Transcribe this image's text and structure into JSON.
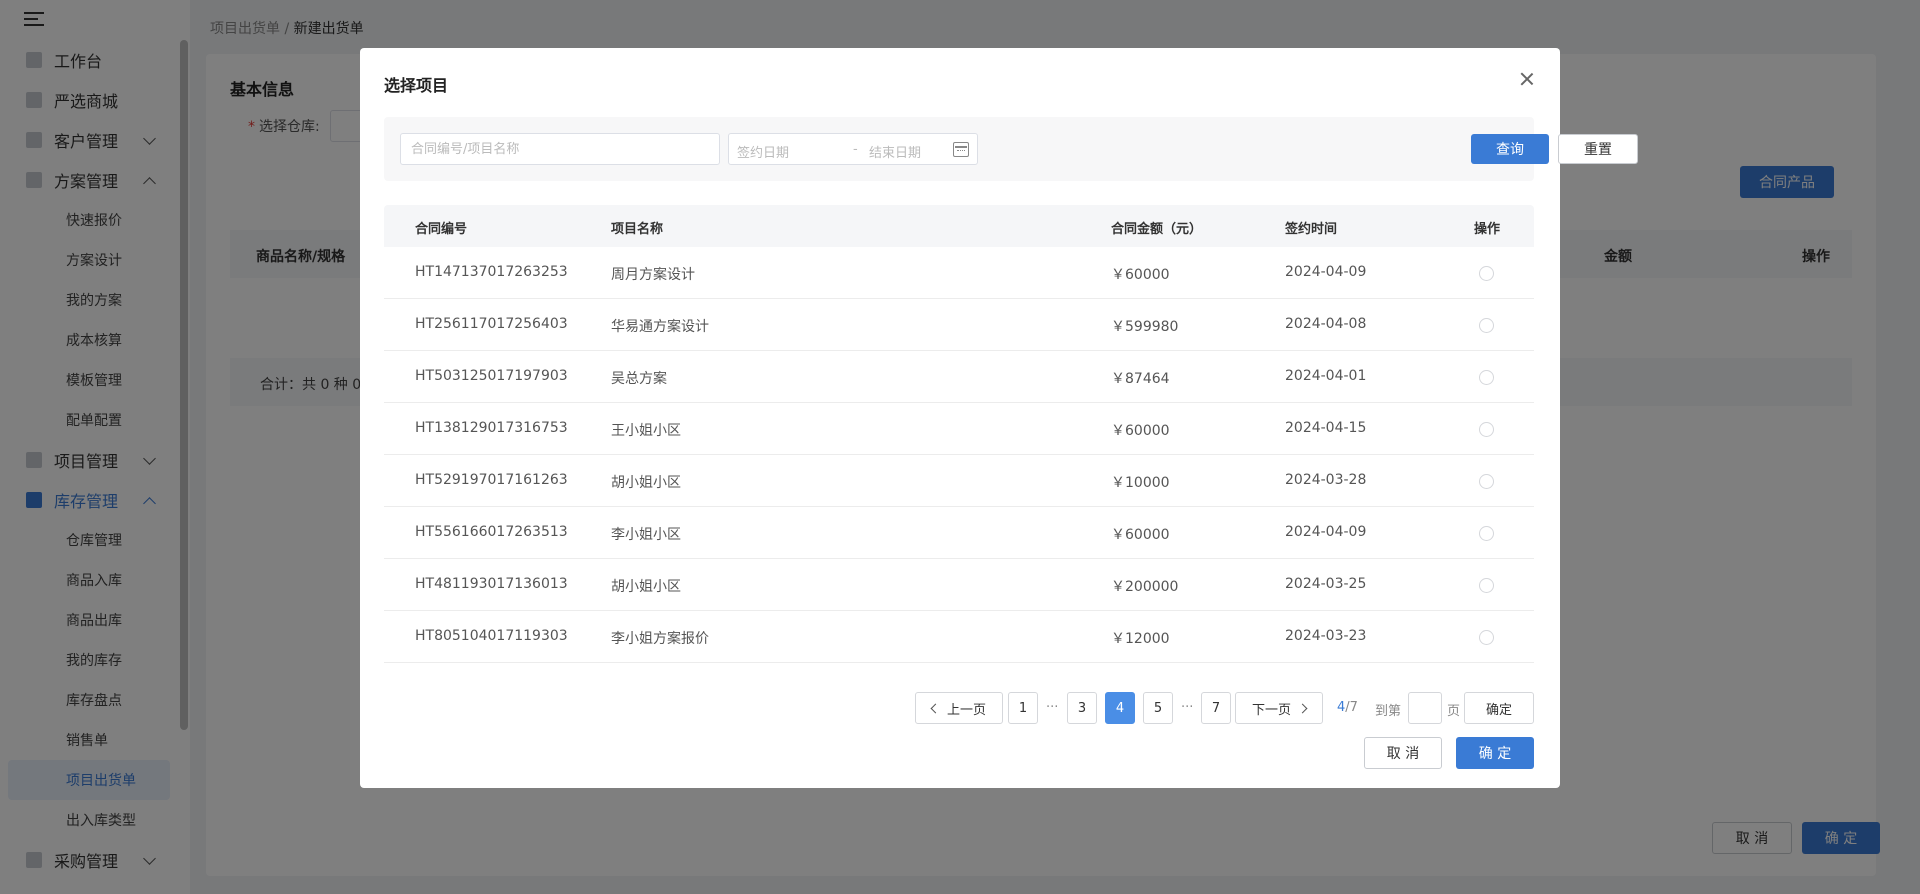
{
  "sidebar": {
    "items": [
      {
        "label": "工作台"
      },
      {
        "label": "严选商城"
      },
      {
        "label": "客户管理"
      },
      {
        "label": "方案管理"
      },
      {
        "label": "项目管理"
      },
      {
        "label": "库存管理"
      },
      {
        "label": "采购管理"
      }
    ],
    "plan_sub": [
      "快速报价",
      "方案设计",
      "我的方案",
      "成本核算",
      "模板管理",
      "配单配置"
    ],
    "stock_sub": [
      "仓库管理",
      "商品入库",
      "商品出库",
      "我的库存",
      "库存盘点",
      "销售单",
      "项目出货单",
      "出入库类型"
    ]
  },
  "breadcrumb": {
    "parent": "项目出货单",
    "sep": "/",
    "current": "新建出货单"
  },
  "page": {
    "title": "基本信息",
    "warehouse_label": "选择仓库:",
    "required_mark": "*",
    "contract_button": "合同产品",
    "table_headers": {
      "name": "商品名称/规格",
      "amount": "金额",
      "op": "操作"
    },
    "total_text": "合计：共 0 种 0",
    "cancel": "取 消",
    "ok": "确 定"
  },
  "modal": {
    "title": "选择项目",
    "search_placeholder": "合同编号/项目名称",
    "date_start": "签约日期",
    "date_sep": "-",
    "date_end": "结束日期",
    "query": "查询",
    "reset": "重置",
    "headers": [
      "合同编号",
      "项目名称",
      "合同金额（元）",
      "签约时间",
      "操作"
    ],
    "rows": [
      {
        "code": "HT147137017263253",
        "name": "周月方案设计",
        "amount": "￥60000",
        "date": "2024-04-09"
      },
      {
        "code": "HT256117017256403",
        "name": "华易通方案设计",
        "amount": "￥599980",
        "date": "2024-04-08"
      },
      {
        "code": "HT503125017197903",
        "name": "吴总方案",
        "amount": "￥87464",
        "date": "2024-04-01"
      },
      {
        "code": "HT138129017316753",
        "name": "王小姐小区",
        "amount": "￥60000",
        "date": "2024-04-15"
      },
      {
        "code": "HT529197017161263",
        "name": "胡小姐小区",
        "amount": "￥10000",
        "date": "2024-03-28"
      },
      {
        "code": "HT556166017263513",
        "name": "李小姐小区",
        "amount": "￥60000",
        "date": "2024-04-09"
      },
      {
        "code": "HT481193017136013",
        "name": "胡小姐小区",
        "amount": "￥200000",
        "date": "2024-03-25"
      },
      {
        "code": "HT805104017119303",
        "name": "李小姐方案报价",
        "amount": "￥12000",
        "date": "2024-03-23"
      }
    ],
    "pager": {
      "prev": "上一页",
      "next": "下一页",
      "pages": [
        "1",
        "3",
        "4",
        "5",
        "7"
      ],
      "dots": "···",
      "current": "4",
      "total": "/7",
      "goto": "到第",
      "page_unit": "页",
      "confirm": "确定"
    },
    "cancel": "取 消",
    "ok": "确 定"
  }
}
